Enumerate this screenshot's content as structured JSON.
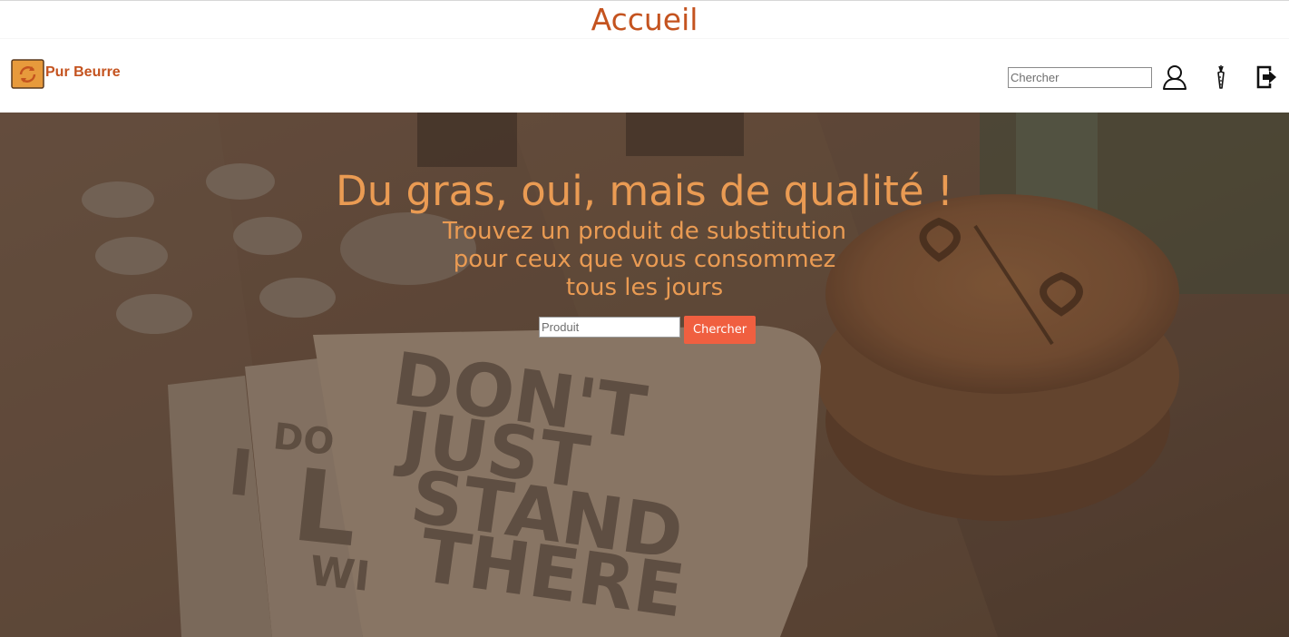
{
  "page": {
    "title": "Accueil"
  },
  "navbar": {
    "brand_name": "Pur Beurre",
    "search_placeholder": "Chercher",
    "icons": [
      "user-icon",
      "carrot-icon",
      "logout-icon"
    ]
  },
  "hero": {
    "title": "Du gras, oui, mais de qualité !",
    "subtitle": "Trouvez un produit de substitution pour ceux que vous consommez tous les jours",
    "search_placeholder": "Produit",
    "search_button": "Chercher",
    "background_text": "DON'T JUST STAND THERE"
  },
  "colors": {
    "brand": "#c4531f",
    "hero_text": "#ea9b53",
    "button": "#f05f40",
    "hero_overlay": "#5a4636"
  }
}
